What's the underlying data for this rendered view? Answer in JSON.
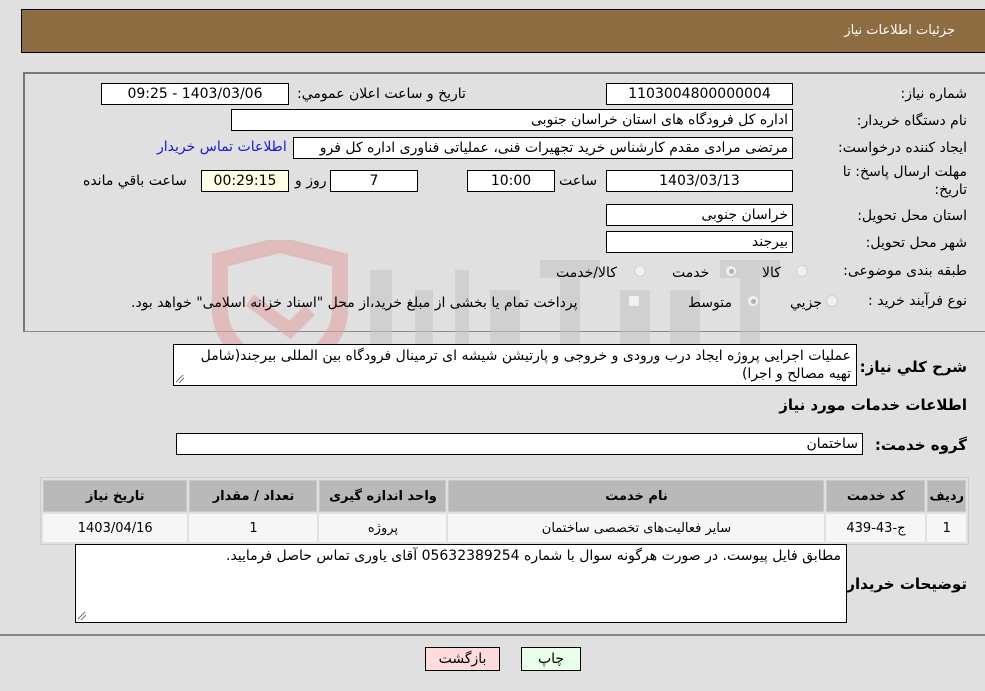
{
  "header": {
    "title": "جزئیات اطلاعات نیاز"
  },
  "form": {
    "need_number": {
      "label": "شماره نیاز:",
      "value": "1103004800000004"
    },
    "announce_datetime": {
      "label": "تاریخ و ساعت اعلان عمومي:",
      "value": "1403/03/06 - 09:25"
    },
    "buyer_org": {
      "label": "نام دستگاه خریدار:",
      "value": "اداره کل فرودگاه های استان خراسان جنوبی"
    },
    "requester": {
      "label": "ایجاد کننده درخواست:",
      "value": "مرتضی مرادی مقدم کارشناس خرید تجهیرات فنی، عملیاتی فناوری اداره کل فرو"
    },
    "buyer_contact_link": "اطلاعات تماس خریدار",
    "deadline": {
      "label_line1": "مهلت ارسال پاسخ: تا",
      "label_line2": "تاریخ:",
      "date": "1403/03/13",
      "time_label": "ساعت",
      "time": "10:00",
      "days": "7",
      "days_label": "روز و",
      "remaining": "00:29:15",
      "remaining_label": "ساعت باقي مانده"
    },
    "delivery_province": {
      "label": "استان محل تحویل:",
      "value": "خراسان جنوبی"
    },
    "delivery_city": {
      "label": "شهر محل تحویل:",
      "value": "بیرجند"
    },
    "category": {
      "label": "طبقه بندی موضوعی:",
      "options": [
        "کالا",
        "خدمت",
        "کالا/خدمت"
      ],
      "selected": "خدمت"
    },
    "purchase_type": {
      "label": "نوع فرآیند خرید :",
      "options": [
        "جزيي",
        "متوسط"
      ],
      "selected": "متوسط",
      "treasury_note": "پرداخت تمام یا بخشی از مبلغ خرید،از محل \"اسناد خزانه اسلامی\" خواهد بود.",
      "treasury_checked": false
    }
  },
  "description": {
    "label": "شرح کلي نیاز:",
    "value": "عملیات اجرایی پروژه ایجاد درب ورودی و خروجی و پارتیشن شیشه ای ترمینال فرودگاه بین المللی بیرجند(شامل تهیه مصالح و اجرا)"
  },
  "services_section_title": "اطلاعات خدمات مورد نیاز",
  "service_group": {
    "label": "گروه خدمت:",
    "value": "ساختمان"
  },
  "table": {
    "headers": [
      "ردیف",
      "کد خدمت",
      "نام خدمت",
      "واحد اندازه گیری",
      "تعداد / مقدار",
      "تاریخ نیاز"
    ],
    "rows": [
      [
        "1",
        "ج-43-439",
        "سایر فعالیت‌های تخصصی ساختمان",
        "پروژه",
        "1",
        "1403/04/16"
      ]
    ]
  },
  "buyer_notes": {
    "label": "توضیحات خریدار:",
    "value": "مطابق فایل پیوست. در صورت هرگونه سوال با شماره 05632389254 آقای یاوری تماس حاصل فرمایید."
  },
  "buttons": {
    "print": "چاپ",
    "back": "بازگشت"
  },
  "colors": {
    "header_bg": "#8d6c42",
    "link": "#1a1ad0",
    "print_bg": "#eaffea",
    "back_bg": "#ffdcdc"
  }
}
